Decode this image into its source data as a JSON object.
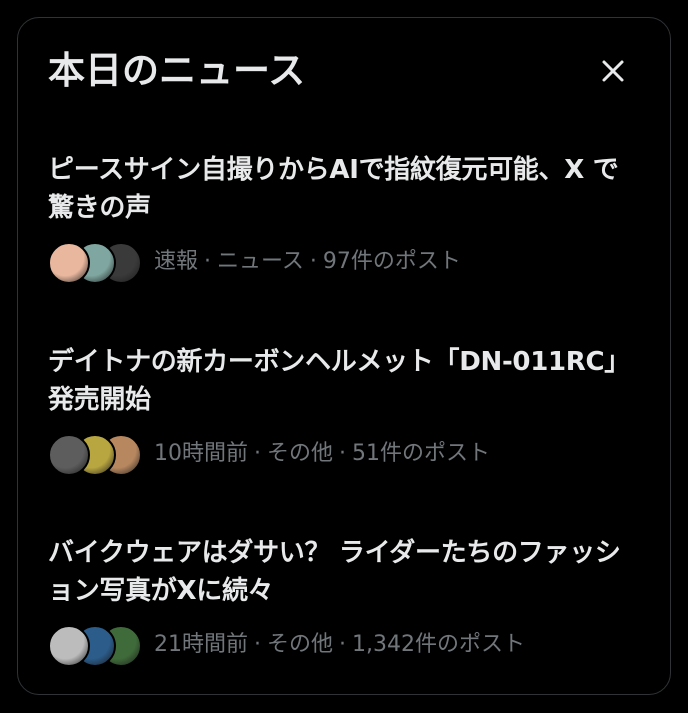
{
  "panel": {
    "title": "本日のニュース",
    "close_icon": "close-icon"
  },
  "news": [
    {
      "headline": "ピースサイン自撮りからAIで指紋復元可能、X で驚きの声",
      "time": "速報",
      "category": "ニュース",
      "posts": "97件のポスト",
      "avatar_colors": [
        "#e8b79e",
        "#7fa6a0",
        "#3a3a3a"
      ]
    },
    {
      "headline": "デイトナの新カーボンヘルメット「DN-011RC」発売開始",
      "time": "10時間前",
      "category": "その他",
      "posts": "51件のポスト",
      "avatar_colors": [
        "#5d5d5d",
        "#b8a640",
        "#b78860"
      ]
    },
    {
      "headline": "バイクウェアはダサい？ ライダーたちのファッション写真がXに続々",
      "time": "21時間前",
      "category": "その他",
      "posts": "1,342件のポスト",
      "avatar_colors": [
        "#bcbcbc",
        "#2b5c8a",
        "#3f6b3a"
      ]
    }
  ],
  "separator": "·"
}
